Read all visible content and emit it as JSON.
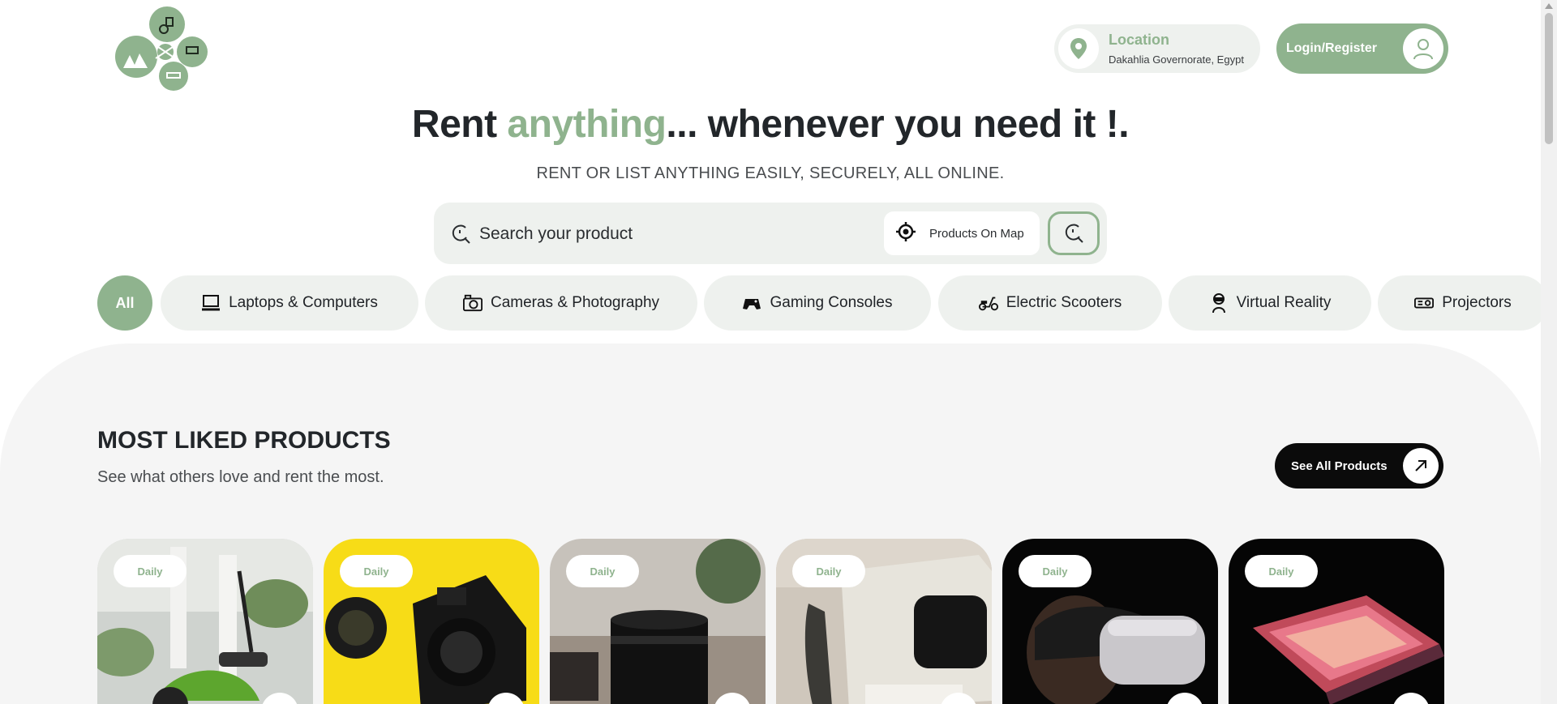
{
  "header": {
    "location_title": "Location",
    "location_value": "Dakahlia Governorate, Egypt",
    "login_label": "Login/Register"
  },
  "hero": {
    "title_before": "Rent ",
    "title_accent": "anything",
    "title_after": "... whenever you need it !.",
    "subtitle": "RENT OR LIST ANYTHING EASILY, SECURELY, ALL ONLINE."
  },
  "search": {
    "placeholder": "Search your product",
    "map_label": "Products On Map"
  },
  "categories": {
    "all_label": "All",
    "items": [
      {
        "label": "Laptops & Computers",
        "icon": "laptop-icon"
      },
      {
        "label": "Cameras & Photography",
        "icon": "camera-icon"
      },
      {
        "label": "Gaming Consoles",
        "icon": "gamepad-icon"
      },
      {
        "label": "Electric Scooters",
        "icon": "scooter-icon"
      },
      {
        "label": "Virtual Reality",
        "icon": "vr-headset-icon"
      },
      {
        "label": "Projectors",
        "icon": "projector-icon"
      }
    ]
  },
  "most_liked": {
    "title": "MOST LIKED PRODUCTS",
    "subtitle": "See what others love and rent the most.",
    "see_all_label": "See All Products",
    "cards": [
      {
        "badge": "Daily",
        "subject": "electric scooter"
      },
      {
        "badge": "Daily",
        "subject": "camera"
      },
      {
        "badge": "Daily",
        "subject": "camera lens"
      },
      {
        "badge": "Daily",
        "subject": "projector"
      },
      {
        "badge": "Daily",
        "subject": "vr headset"
      },
      {
        "badge": "Daily",
        "subject": "laptop"
      }
    ]
  },
  "colors": {
    "accent": "#8fb38e",
    "pill_bg": "#eef1ee",
    "dark": "#0b0b0b"
  }
}
